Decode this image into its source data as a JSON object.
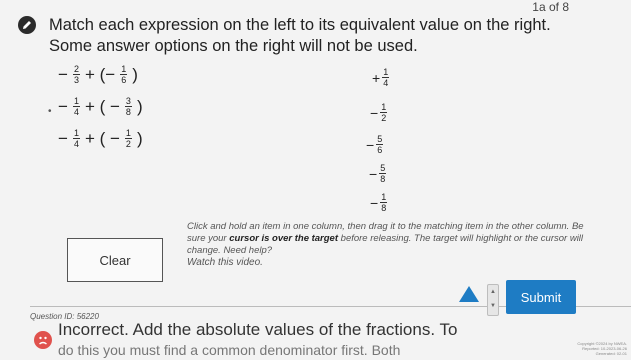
{
  "page_counter": "1a of 8",
  "instructions": "Match each expression on the left to its equivalent value on the right. Some answer options on the right will not be used.",
  "expressions": [
    {
      "lead": "−",
      "a_num": "2",
      "a_den": "3",
      "op": "+ (−",
      "b_num": "1",
      "b_den": "6",
      "close": ")"
    },
    {
      "lead": "−",
      "a_num": "1",
      "a_den": "4",
      "op": "+ ( −",
      "b_num": "3",
      "b_den": "8",
      "close": ")"
    },
    {
      "lead": "−",
      "a_num": "1",
      "a_den": "4",
      "op": "+ ( −",
      "b_num": "1",
      "b_den": "2",
      "close": ")"
    }
  ],
  "answer_values": [
    {
      "sign": "+",
      "num": "1",
      "den": "4"
    },
    {
      "sign": "−",
      "num": "1",
      "den": "2"
    },
    {
      "sign": "−",
      "num": "5",
      "den": "6"
    },
    {
      "sign": "−",
      "num": "5",
      "den": "8"
    },
    {
      "sign": "−",
      "num": "1",
      "den": "8"
    }
  ],
  "clear_label": "Clear",
  "help": {
    "part1": "Click and hold an item in one column, then drag it to the matching item in the other column. Be sure your ",
    "bold": "cursor is over the target",
    "part2": " before releasing. The target will highlight or the cursor will change. Need help?",
    "video_link": "Watch this video."
  },
  "question_id": "Question ID: 56220",
  "feedback": "Incorrect. Add the absolute values of the fractions. To",
  "feedback_line2": "do this you must find a common denominator first. Both",
  "submit_label": "Submit",
  "footer_legal": "Copyright ©2024 by NWEA. Reported: 10-2023-06-26 Generated: 02-01"
}
